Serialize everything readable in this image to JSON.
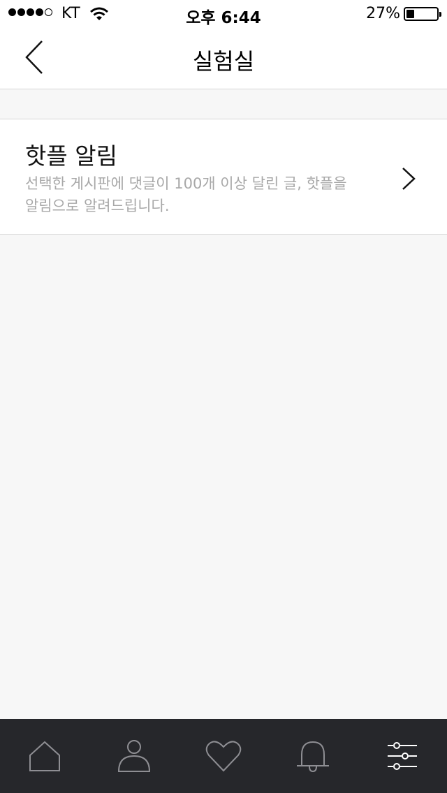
{
  "status_bar": {
    "carrier": "KT",
    "time": "오후 6:44",
    "battery_percent": "27%",
    "battery_level": 0.27,
    "signal_bars_filled": 4,
    "signal_bars_total": 5,
    "icons": [
      "signal-dots",
      "wifi-icon",
      "battery-icon"
    ]
  },
  "nav": {
    "title": "실험실",
    "back_icon": "chevron-left-icon"
  },
  "settings": {
    "items": [
      {
        "title": "핫플 알림",
        "description": "선택한 게시판에 댓글이 100개 이상 달린 글, 핫플을 알림으로 알려드립니다.",
        "icon": "chevron-right-icon"
      }
    ]
  },
  "tab_bar": {
    "background": "#26272b",
    "icon_color": "#8e8e93",
    "active_color": "#ffffff",
    "active_index": 4,
    "tabs": [
      {
        "icon": "home-icon"
      },
      {
        "icon": "profile-icon"
      },
      {
        "icon": "heart-icon"
      },
      {
        "icon": "bell-icon"
      },
      {
        "icon": "settings-sliders-icon"
      }
    ]
  }
}
